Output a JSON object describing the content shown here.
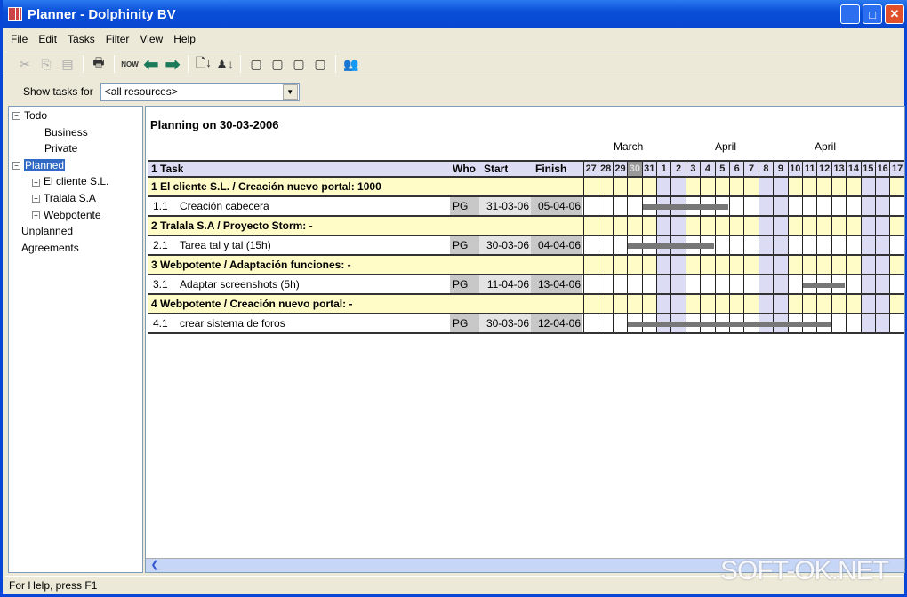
{
  "window": {
    "title": "Planner - Dolphinity BV"
  },
  "menu": [
    "File",
    "Edit",
    "Tasks",
    "Filter",
    "View",
    "Help"
  ],
  "toolbar": {
    "now_label": "NOW"
  },
  "filter": {
    "label": "Show tasks for",
    "value": "<all resources>"
  },
  "tree": [
    {
      "label": "Todo",
      "expander": "−"
    },
    {
      "label": "Business"
    },
    {
      "label": "Private"
    },
    {
      "label": "Planned",
      "expander": "−",
      "selected": true
    },
    {
      "label": "El cliente S.L.",
      "expander": "+"
    },
    {
      "label": "Tralala S.A",
      "expander": "+"
    },
    {
      "label": "Webpotente",
      "expander": "+"
    },
    {
      "label": "Unplanned"
    },
    {
      "label": "Agreements"
    }
  ],
  "planning": {
    "title": "Planning on 30-03-2006",
    "months": [
      "March",
      "April",
      "April"
    ],
    "headers": {
      "task": "1 Task",
      "who": "Who",
      "start": "Start",
      "finish": "Finish"
    },
    "days": [
      "27",
      "28",
      "29",
      "30",
      "31",
      "1",
      "2",
      "3",
      "4",
      "5",
      "6",
      "7",
      "8",
      "9",
      "10",
      "11",
      "12",
      "13",
      "14",
      "15",
      "16",
      "17"
    ],
    "today": "30",
    "weekends": [
      "1",
      "2",
      "8",
      "9",
      "15",
      "16"
    ],
    "colors": {
      "group": "#fffcc8",
      "weekend": "#dcdcf4",
      "bar": "#777777"
    },
    "rows": [
      {
        "type": "group",
        "label": "1 El cliente S.L. / Creación nuevo portal: 1000"
      },
      {
        "type": "task",
        "num": "1.1",
        "label": "Creación cabecera",
        "who": "PG",
        "start": "31-03-06",
        "finish": "05-04-06"
      },
      {
        "type": "group",
        "label": "2 Tralala S.A / Proyecto Storm: -"
      },
      {
        "type": "task",
        "num": "2.1",
        "label": "Tarea tal y tal (15h)",
        "who": "PG",
        "start": "30-03-06",
        "finish": "04-04-06"
      },
      {
        "type": "group",
        "label": "3 Webpotente / Adaptación funciones: -"
      },
      {
        "type": "task",
        "num": "3.1",
        "label": "Adaptar screenshots (5h)",
        "who": "PG",
        "start": "11-04-06",
        "finish": "13-04-06"
      },
      {
        "type": "group",
        "label": "4 Webpotente / Creación nuevo portal: -"
      },
      {
        "type": "task",
        "num": "4.1",
        "label": "crear sistema de foros",
        "who": "PG",
        "start": "30-03-06",
        "finish": "12-04-06"
      }
    ]
  },
  "status": {
    "help": "For Help, press F1"
  },
  "watermark": "SOFT-OK.NET"
}
